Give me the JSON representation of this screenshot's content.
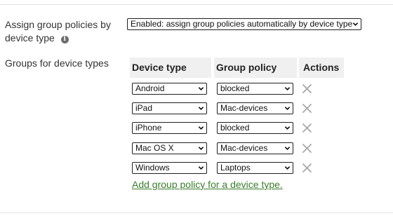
{
  "settings": {
    "assign_label": "Assign group policies by device type",
    "policy_mode": {
      "value": "Enabled: assign group policies automatically by device type"
    },
    "groups_label": "Groups for device types"
  },
  "table": {
    "headers": {
      "device_type": "Device type",
      "group_policy": "Group policy",
      "actions": "Actions"
    },
    "rows": [
      {
        "device_type": "Android",
        "group_policy": "blocked"
      },
      {
        "device_type": "iPad",
        "group_policy": "Mac-devices"
      },
      {
        "device_type": "iPhone",
        "group_policy": "blocked"
      },
      {
        "device_type": "Mac OS X",
        "group_policy": "Mac-devices"
      },
      {
        "device_type": "Windows",
        "group_policy": "Laptops"
      }
    ]
  },
  "add_link": "Add group policy for a device type.",
  "colors": {
    "link": "#3a7d2c",
    "header_bg": "#f0f0f0",
    "delete_icon": "#a8a8a8"
  },
  "icons": {
    "info": "info-icon",
    "dropdown": "chevron-down-icon",
    "delete": "close-icon"
  }
}
